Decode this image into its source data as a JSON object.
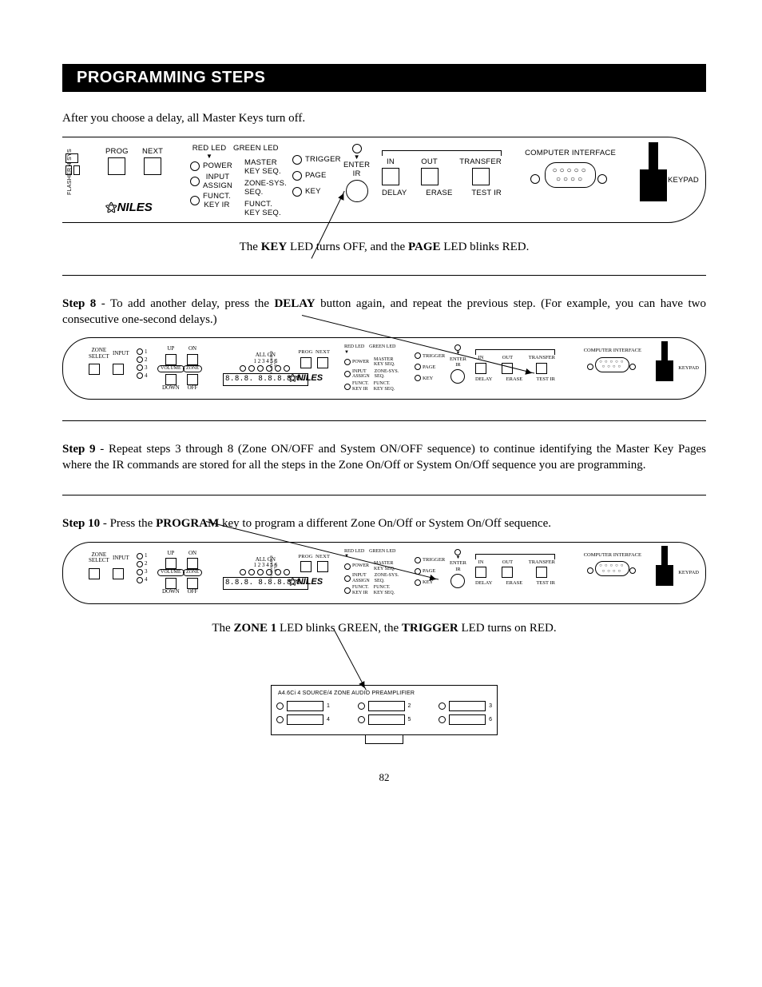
{
  "header": "PROGRAMMING STEPS",
  "intro": "After you choose a delay, all Master Keys turn off.",
  "panel1": {
    "side_text1": "FLASHER 4",
    "side_text2": "SYS",
    "prog": "PROG",
    "next": "NEXT",
    "brand": "NILES",
    "red_led": "RED LED",
    "green_led": "GREEN LED",
    "power": "POWER",
    "input_assign": "INPUT\nASSIGN",
    "funct_key_ir": "FUNCT.\nKEY IR",
    "master_key_seq": "MASTER\nKEY SEQ.",
    "zone_sys_seq": "ZONE-SYS.\nSEQ.",
    "funct_key_seq": "FUNCT.\nKEY SEQ.",
    "trigger": "TRIGGER",
    "page_lbl": "PAGE",
    "key_lbl": "KEY",
    "enter_ir": "ENTER\nIR",
    "in": "IN",
    "out": "OUT",
    "transfer": "TRANSFER",
    "delay": "DELAY",
    "erase": "ERASE",
    "test_ir": "TEST IR",
    "computer_interface": "COMPUTER INTERFACE",
    "keypad": "KEYPAD"
  },
  "caption1_a": "The ",
  "caption1_b": "KEY",
  "caption1_c": " LED turns OFF, and the ",
  "caption1_d": "PAGE",
  "caption1_e": " LED blinks RED.",
  "step8_a": "Step 8",
  "step8_b": " - To add another delay, press the ",
  "step8_c": "DELAY",
  "step8_d": " button again, and repeat the previous step. (For example, you can have two consecutive one-second delays.)",
  "panel_small": {
    "zone_select": "ZONE\nSELECT",
    "input": "INPUT",
    "up": "UP",
    "on": "ON",
    "down": "DOWN",
    "off": "OFF",
    "volume": "VOLUME",
    "zone": "ZONE",
    "all_on": "ALL ON",
    "all_on_nums": "1 2 3 4 5 6",
    "seg_display": "8.8.8. 8.8.8.8.8.",
    "n1": "1",
    "n2": "2",
    "n3": "3",
    "n4": "4"
  },
  "step9_a": "Step 9",
  "step9_b": " - Repeat steps 3 through 8 (Zone ON/OFF and System ON/OFF sequence) to continue identifying the Master Key Pages where the IR commands are stored for all the steps in the Zone On/Off or System On/Off sequence you are programming.",
  "step10_a": "Step 10",
  "step10_b": " - Press the ",
  "step10_c": "PROGRAM",
  "step10_d": " key to program a different Zone On/Off or System On/Off sequence.",
  "caption2_a": "The ",
  "caption2_b": "ZONE 1",
  "caption2_c": " LED blinks GREEN, the ",
  "caption2_d": "TRIGGER",
  "caption2_e": " LED turns on RED.",
  "front_unit_title": "A4.6Ci  4 SOURCE/4 ZONE AUDIO PREAMPLIFIER",
  "fu": {
    "1": "1",
    "2": "2",
    "3": "3",
    "4": "4",
    "5": "5",
    "6": "6"
  },
  "page_number": "82"
}
